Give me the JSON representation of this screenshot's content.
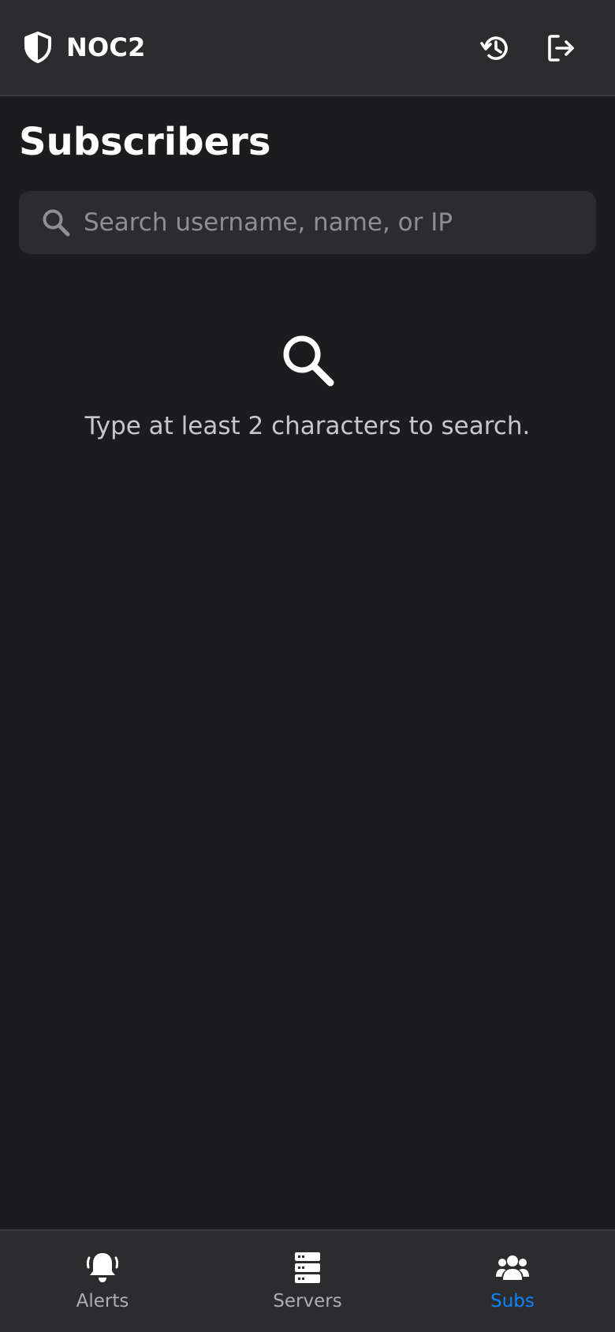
{
  "header": {
    "app_title": "NOC2",
    "brand_icon": "shield-icon",
    "history_icon": "history-icon",
    "logout_icon": "logout-icon"
  },
  "main": {
    "title": "Subscribers",
    "search": {
      "placeholder": "Search username, name, or IP",
      "value": "",
      "icon": "search-icon"
    },
    "empty_state": {
      "icon": "search-icon",
      "message": "Type at least 2 characters to search."
    }
  },
  "tabbar": {
    "active_tab": "Subs",
    "tabs": [
      {
        "label": "Alerts",
        "icon": "bell-icon"
      },
      {
        "label": "Servers",
        "icon": "server-icon"
      },
      {
        "label": "Subs",
        "icon": "users-icon"
      }
    ]
  },
  "colors": {
    "background": "#1c1c1e",
    "surface": "#2c2c2e",
    "accent": "#0a84ff",
    "muted_text": "#aeaeb2"
  }
}
